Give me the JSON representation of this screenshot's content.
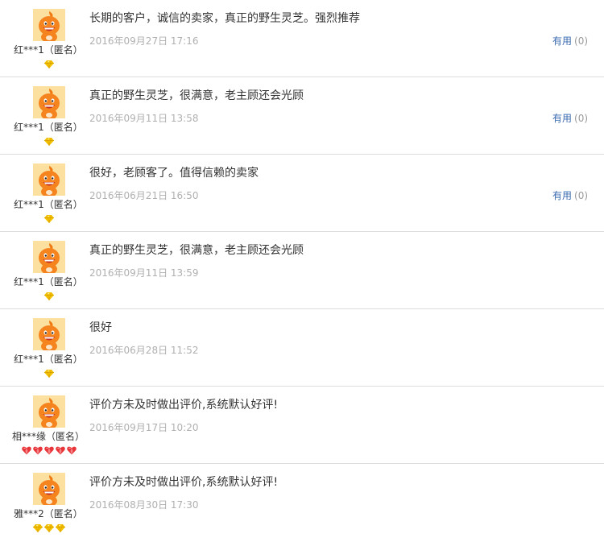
{
  "colors": {
    "divider": "#dcdcdc",
    "comment_text": "#333333",
    "date_text": "#b0b0b0",
    "useful_link": "#3a6ab0",
    "diamond_yellow": "#f5c400",
    "heart_red": "#e8353a"
  },
  "reviews": [
    {
      "user": "红***1（匿名）",
      "comment": "长期的客户，诚信的卖家，真正的野生灵芝。强烈推荐",
      "date": "2016年09月27日 17:16",
      "useful_label": "有用",
      "useful_count": "(0)",
      "badge_icon": "yellow-diamond-icon",
      "badge_count": 1
    },
    {
      "user": "红***1（匿名）",
      "comment": "真正的野生灵芝，很满意，老主顾还会光顾",
      "date": "2016年09月11日 13:58",
      "useful_label": "有用",
      "useful_count": "(0)",
      "badge_icon": "yellow-diamond-icon",
      "badge_count": 1
    },
    {
      "user": "红***1（匿名）",
      "comment": "很好，老顾客了。值得信赖的卖家",
      "date": "2016年06月21日 16:50",
      "useful_label": "有用",
      "useful_count": "(0)",
      "badge_icon": "yellow-diamond-icon",
      "badge_count": 1
    },
    {
      "user": "红***1（匿名）",
      "comment": "真正的野生灵芝，很满意，老主顾还会光顾",
      "date": "2016年09月11日 13:59",
      "badge_icon": "yellow-diamond-icon",
      "badge_count": 1
    },
    {
      "user": "红***1（匿名）",
      "comment": "很好",
      "date": "2016年06月28日 11:52",
      "badge_icon": "yellow-diamond-icon",
      "badge_count": 1
    },
    {
      "user": "相***缘（匿名）",
      "comment": "评价方未及时做出评价,系统默认好评!",
      "date": "2016年09月17日 10:20",
      "badge_icon": "red-heart-icon",
      "badge_count": 5
    },
    {
      "user": "雅***2（匿名）",
      "comment": "评价方未及时做出评价,系统默认好评!",
      "date": "2016年08月30日 17:30",
      "badge_icon": "yellow-diamond-icon",
      "badge_count": 3
    }
  ]
}
